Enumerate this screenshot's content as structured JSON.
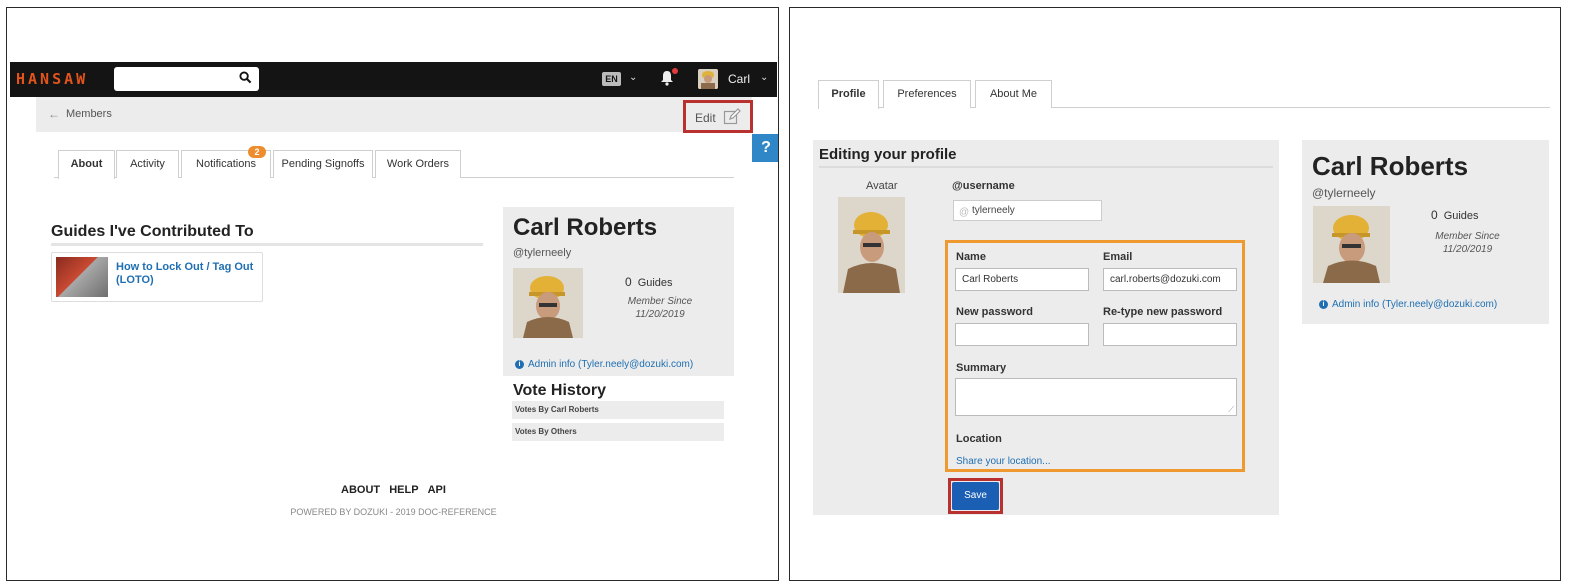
{
  "left": {
    "navbar": {
      "brand": "HANSAW",
      "search_value": "",
      "lang": "EN",
      "user": "Carl"
    },
    "subbar": {
      "back_label": "←",
      "breadcrumb": "Members",
      "edit_label": "Edit"
    },
    "help_label": "?",
    "tabs": [
      {
        "label": "About"
      },
      {
        "label": "Activity"
      },
      {
        "label": "Notifications"
      },
      {
        "label": "Pending Signoffs"
      },
      {
        "label": "Work Orders"
      }
    ],
    "notification_count": "2",
    "guides_heading": "Guides I've Contributed To",
    "guide_title": "How to Lock Out / Tag Out (LOTO)",
    "profile": {
      "name": "Carl Roberts",
      "username": "@tylerneely",
      "guides_count": "0",
      "guides_label": "Guides",
      "member_since_label": "Member Since",
      "member_since_date": "11/20/2019",
      "admin_info": "Admin info (Tyler.neely@dozuki.com)"
    },
    "vote_history": {
      "heading": "Vote History",
      "rows": [
        "Votes By Carl Roberts",
        "Votes By Others"
      ]
    },
    "footer": {
      "links": [
        "ABOUT",
        "HELP",
        "API"
      ],
      "powered": "POWERED BY DOZUKI - 2019 DOC-REFERENCE"
    }
  },
  "right": {
    "tabs": [
      {
        "label": "Profile"
      },
      {
        "label": "Preferences"
      },
      {
        "label": "About Me"
      }
    ],
    "edit": {
      "title": "Editing your profile",
      "avatar_label": "Avatar",
      "username_label": "@username",
      "username_value": "tylerneely",
      "name_label": "Name",
      "name_value": "Carl Roberts",
      "email_label": "Email",
      "email_value": "carl.roberts@dozuki.com",
      "new_password_label": "New password",
      "retype_password_label": "Re-type new password",
      "summary_label": "Summary",
      "location_label": "Location",
      "share_location": "Share your location...",
      "save_label": "Save"
    },
    "profile": {
      "name": "Carl Roberts",
      "username": "@tylerneely",
      "guides_count": "0",
      "guides_label": "Guides",
      "member_since_label": "Member Since",
      "member_since_date": "11/20/2019",
      "admin_info": "Admin info (Tyler.neely@dozuki.com)"
    }
  },
  "colors": {
    "brand": "#e2541b",
    "link": "#1f6fb2",
    "highlight_red": "#b8312f",
    "highlight_orange": "#ee9a30",
    "save_button": "#1a5fb4",
    "badge": "#ee8d2d"
  }
}
